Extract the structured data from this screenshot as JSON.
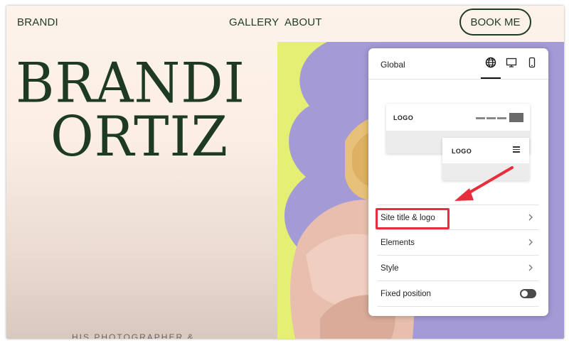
{
  "nav": {
    "brand": "BRANDI",
    "links": [
      "GALLERY",
      "ABOUT"
    ],
    "cta": "BOOK ME"
  },
  "hero": {
    "first_name": "BRANDI",
    "last_name": "ORTIZ",
    "cut_text": "HIS PHOTOGRAPHER &"
  },
  "panel": {
    "title": "Global",
    "tabs": [
      "globe-icon",
      "desktop-icon",
      "mobile-icon"
    ],
    "active_tab": "globe-icon",
    "preview_logo_label": "LOGO",
    "items": [
      {
        "label": "Site title & logo",
        "control": "chevron"
      },
      {
        "label": "Elements",
        "control": "chevron"
      },
      {
        "label": "Style",
        "control": "chevron"
      },
      {
        "label": "Fixed position",
        "control": "toggle",
        "enabled": false
      }
    ]
  },
  "colors": {
    "text_green": "#1f3a22",
    "photo_background": "#e4ef74",
    "blob_purple": "#a39ad6",
    "highlight_red": "#ea2d3d"
  }
}
